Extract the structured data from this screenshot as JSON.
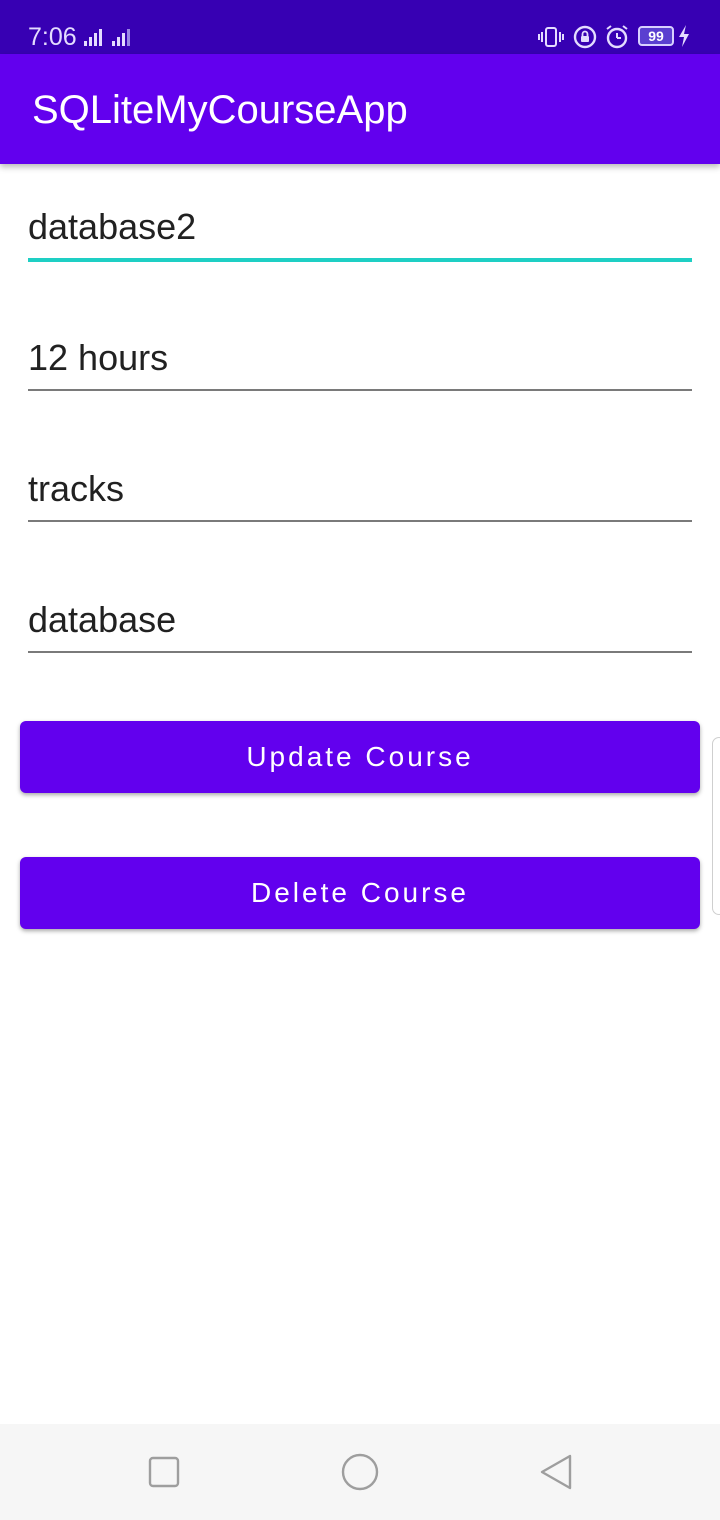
{
  "status_bar": {
    "time": "7:06",
    "battery": "99",
    "icons": [
      "signal-icon",
      "signal-icon",
      "vibrate-icon",
      "rotation-lock-icon",
      "alarm-icon",
      "battery-icon",
      "charging-icon"
    ]
  },
  "app_bar": {
    "title": "SQLiteMyCourseApp"
  },
  "form": {
    "fields": [
      {
        "value": "database2",
        "focused": true
      },
      {
        "value": "12 hours",
        "focused": false
      },
      {
        "value": "tracks",
        "focused": false
      },
      {
        "value": "database",
        "focused": false
      }
    ],
    "update_label": "Update Course",
    "delete_label": "Delete Course"
  },
  "nav_bar": {
    "icons": [
      "recent-apps-icon",
      "home-icon",
      "back-icon"
    ]
  },
  "colors": {
    "status_bar": "#3700b3",
    "primary": "#6200ee",
    "focus_accent": "#1ecfc4"
  }
}
